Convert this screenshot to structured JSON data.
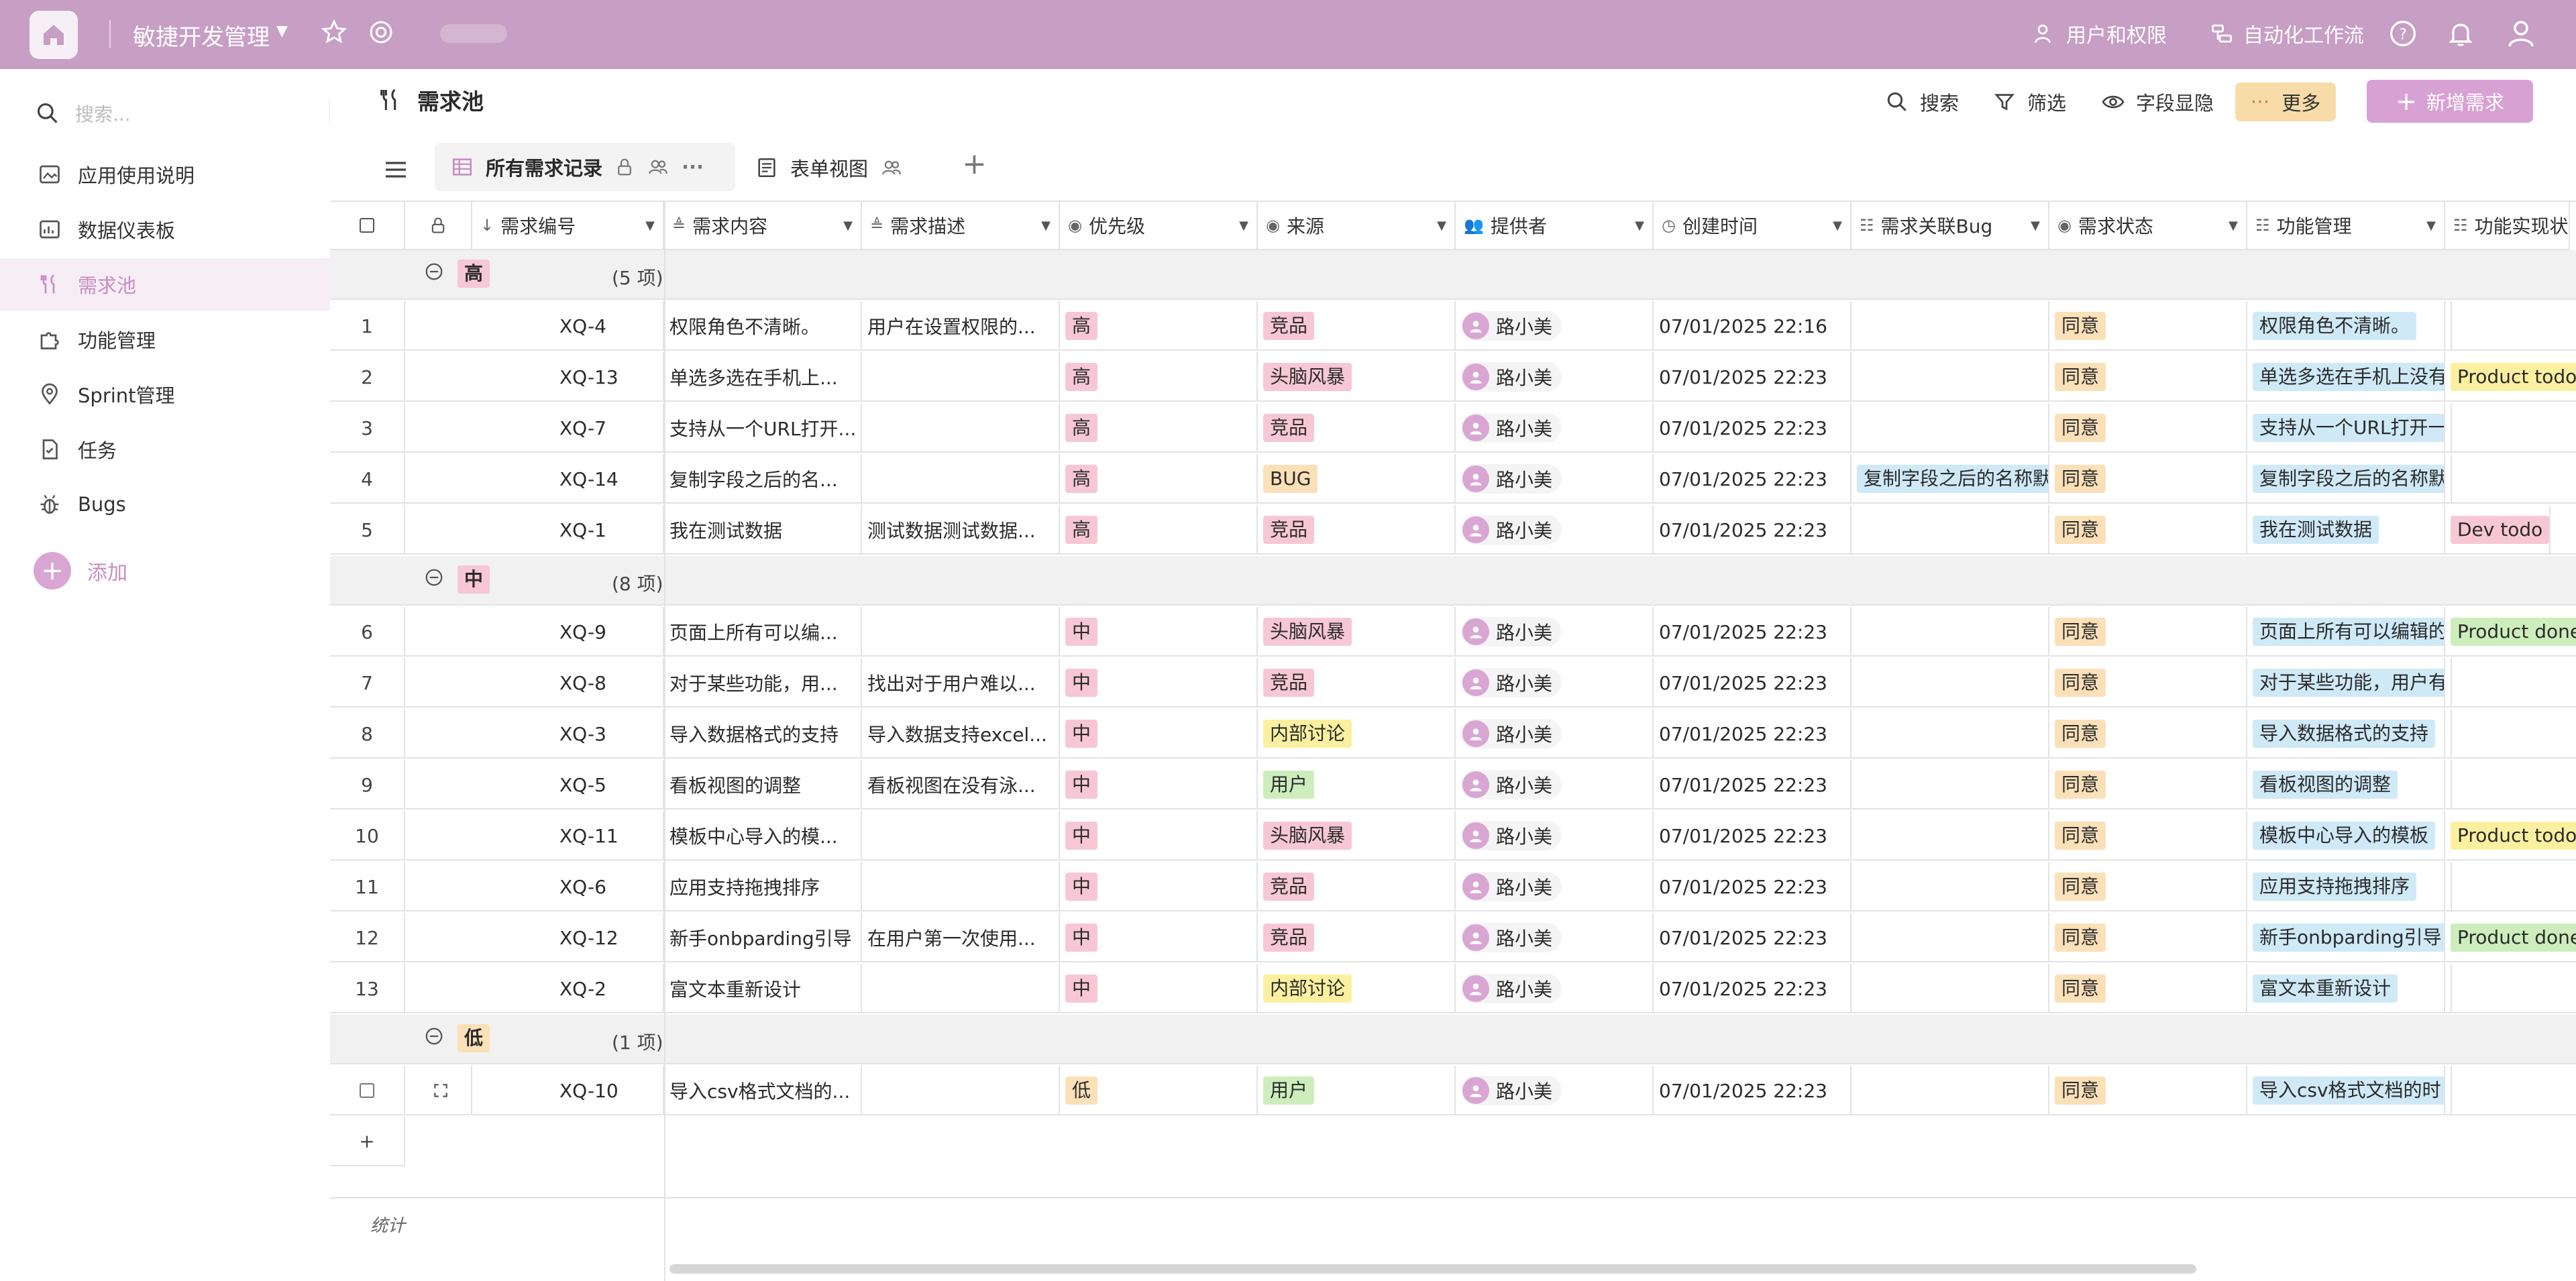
{
  "topbar": {
    "app_name": "敏捷开发管理",
    "users_permissions": "用户和权限",
    "automation": "自动化工作流"
  },
  "sidebar": {
    "search_placeholder": "搜索...",
    "items": [
      {
        "label": "应用使用说明",
        "icon": "image-icon"
      },
      {
        "label": "数据仪表板",
        "icon": "dashboard-icon"
      },
      {
        "label": "需求池",
        "icon": "fork-icon",
        "active": true
      },
      {
        "label": "功能管理",
        "icon": "puzzle-icon"
      },
      {
        "label": "Sprint管理",
        "icon": "location-icon"
      },
      {
        "label": "任务",
        "icon": "task-icon"
      },
      {
        "label": "Bugs",
        "icon": "bug-icon"
      }
    ],
    "add_label": "添加"
  },
  "header": {
    "title": "需求池",
    "search": "搜索",
    "filter": "筛选",
    "fields": "字段显隐",
    "more": "更多",
    "new": "新增需求"
  },
  "tabs": {
    "all_records": "所有需求记录",
    "form_view": "表单视图"
  },
  "columns": [
    "需求编号",
    "需求内容",
    "需求描述",
    "优先级",
    "来源",
    "提供者",
    "创建时间",
    "需求关联Bug",
    "需求状态",
    "功能管理",
    "功能实现状"
  ],
  "groups": [
    {
      "label": "高",
      "count": "(5 项)",
      "color": "#f7c7d6"
    },
    {
      "label": "中",
      "count": "(8 项)",
      "color": "#f7c7d6"
    },
    {
      "label": "低",
      "count": "(1 项)",
      "color": "#fbe0b8"
    }
  ],
  "rows": [
    {
      "num": "1",
      "id": "XQ-4",
      "content": "权限角色不清晰。",
      "desc": "用户在设置权限的...",
      "priority": "高",
      "source": "竞品",
      "provider": "路小美",
      "created": "07/01/2025 22:16",
      "bug": "",
      "status": "同意",
      "feature": "权限角色不清晰。",
      "impl": ""
    },
    {
      "num": "2",
      "id": "XQ-13",
      "content": "单选多选在手机上...",
      "desc": "",
      "priority": "高",
      "source": "头脑风暴",
      "provider": "路小美",
      "created": "07/01/2025 22:23",
      "bug": "",
      "status": "同意",
      "feature": "单选多选在手机上没有",
      "impl": "Product todo"
    },
    {
      "num": "3",
      "id": "XQ-7",
      "content": "支持从一个URL打开...",
      "desc": "",
      "priority": "高",
      "source": "竞品",
      "provider": "路小美",
      "created": "07/01/2025 22:23",
      "bug": "",
      "status": "同意",
      "feature": "支持从一个URL打开一",
      "impl": ""
    },
    {
      "num": "4",
      "id": "XQ-14",
      "content": "复制字段之后的名...",
      "desc": "",
      "priority": "高",
      "source": "BUG",
      "provider": "路小美",
      "created": "07/01/2025 22:23",
      "bug": "复制字段之后的名称默",
      "status": "同意",
      "feature": "复制字段之后的名称默",
      "impl": ""
    },
    {
      "num": "5",
      "id": "XQ-1",
      "content": "我在测试数据",
      "desc": "测试数据测试数据...",
      "priority": "高",
      "source": "竞品",
      "provider": "路小美",
      "created": "07/01/2025 22:23",
      "bug": "",
      "status": "同意",
      "feature": "我在测试数据",
      "impl": "Dev todo"
    },
    {
      "num": "6",
      "id": "XQ-9",
      "content": "页面上所有可以编...",
      "desc": "",
      "priority": "中",
      "source": "头脑风暴",
      "provider": "路小美",
      "created": "07/01/2025 22:23",
      "bug": "",
      "status": "同意",
      "feature": "页面上所有可以编辑的",
      "impl": "Product done"
    },
    {
      "num": "7",
      "id": "XQ-8",
      "content": "对于某些功能，用...",
      "desc": "找出对于用户难以...",
      "priority": "中",
      "source": "竞品",
      "provider": "路小美",
      "created": "07/01/2025 22:23",
      "bug": "",
      "status": "同意",
      "feature": "对于某些功能，用户有",
      "impl": ""
    },
    {
      "num": "8",
      "id": "XQ-3",
      "content": "导入数据格式的支持",
      "desc": "导入数据支持excel...",
      "priority": "中",
      "source": "内部讨论",
      "provider": "路小美",
      "created": "07/01/2025 22:23",
      "bug": "",
      "status": "同意",
      "feature": "导入数据格式的支持",
      "impl": ""
    },
    {
      "num": "9",
      "id": "XQ-5",
      "content": "看板视图的调整",
      "desc": "看板视图在没有泳...",
      "priority": "中",
      "source": "用户",
      "provider": "路小美",
      "created": "07/01/2025 22:23",
      "bug": "",
      "status": "同意",
      "feature": "看板视图的调整",
      "impl": ""
    },
    {
      "num": "10",
      "id": "XQ-11",
      "content": "模板中心导入的模...",
      "desc": "",
      "priority": "中",
      "source": "头脑风暴",
      "provider": "路小美",
      "created": "07/01/2025 22:23",
      "bug": "",
      "status": "同意",
      "feature": "模板中心导入的模板",
      "impl": "Product todo"
    },
    {
      "num": "11",
      "id": "XQ-6",
      "content": "应用支持拖拽排序",
      "desc": "",
      "priority": "中",
      "source": "竞品",
      "provider": "路小美",
      "created": "07/01/2025 22:23",
      "bug": "",
      "status": "同意",
      "feature": "应用支持拖拽排序",
      "impl": ""
    },
    {
      "num": "12",
      "id": "XQ-12",
      "content": "新手onbparding引导",
      "desc": "在用户第一次使用...",
      "priority": "中",
      "source": "竞品",
      "provider": "路小美",
      "created": "07/01/2025 22:23",
      "bug": "",
      "status": "同意",
      "feature": "新手onbparding引导",
      "impl": "Product done"
    },
    {
      "num": "13",
      "id": "XQ-2",
      "content": "富文本重新设计",
      "desc": "",
      "priority": "中",
      "source": "内部讨论",
      "provider": "路小美",
      "created": "07/01/2025 22:23",
      "bug": "",
      "status": "同意",
      "feature": "富文本重新设计",
      "impl": ""
    },
    {
      "num": "",
      "id": "XQ-10",
      "content": "导入csv格式文档的...",
      "desc": "",
      "priority": "低",
      "source": "用户",
      "provider": "路小美",
      "created": "07/01/2025 22:23",
      "bug": "",
      "status": "同意",
      "feature": "导入csv格式文档的时",
      "impl": ""
    }
  ],
  "footer": {
    "stats": "统计",
    "add_row": "+"
  },
  "colors": {
    "topbar": "#c79ec4",
    "accent": "#c88cc3",
    "tag_pink": "#f7c7d6",
    "tag_orange": "#fbe0b8",
    "tag_yellow": "#fbf0a0",
    "tag_green": "#cdeebc",
    "tag_blue": "#cfe9f7"
  }
}
